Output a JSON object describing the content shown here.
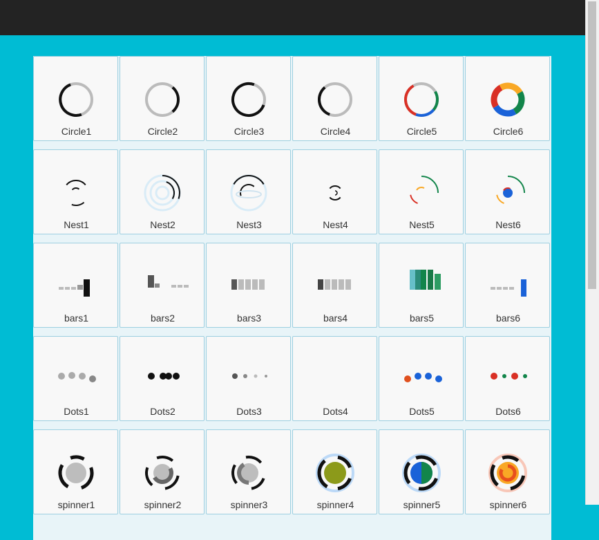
{
  "colors": {
    "page_bg": "#00bcd4",
    "topbar_bg": "#232323",
    "tile_bg": "#f8f8f8",
    "tile_border": "#9ccfe0",
    "label": "#333333",
    "black": "#111111",
    "gray": "#bbbbbb",
    "red": "#d93025",
    "blue": "#1a62d8",
    "green": "#12854a",
    "yellow": "#f9a825",
    "olive": "#8c9a1a",
    "teal": "#66bfc9"
  },
  "grid": {
    "rows": [
      [
        "Circle1",
        "Circle2",
        "Circle3",
        "Circle4",
        "Circle5",
        "Circle6"
      ],
      [
        "Nest1",
        "Nest2",
        "Nest3",
        "Nest4",
        "Nest5",
        "Nest6"
      ],
      [
        "bars1",
        "bars2",
        "bars3",
        "bars4",
        "bars5",
        "bars6"
      ],
      [
        "Dots1",
        "Dots2",
        "Dots3",
        "Dots4",
        "Dots5",
        "Dots6"
      ],
      [
        "spinner1",
        "spinner2",
        "spinner3",
        "spinner4",
        "spinner5",
        "spinner6"
      ]
    ]
  }
}
